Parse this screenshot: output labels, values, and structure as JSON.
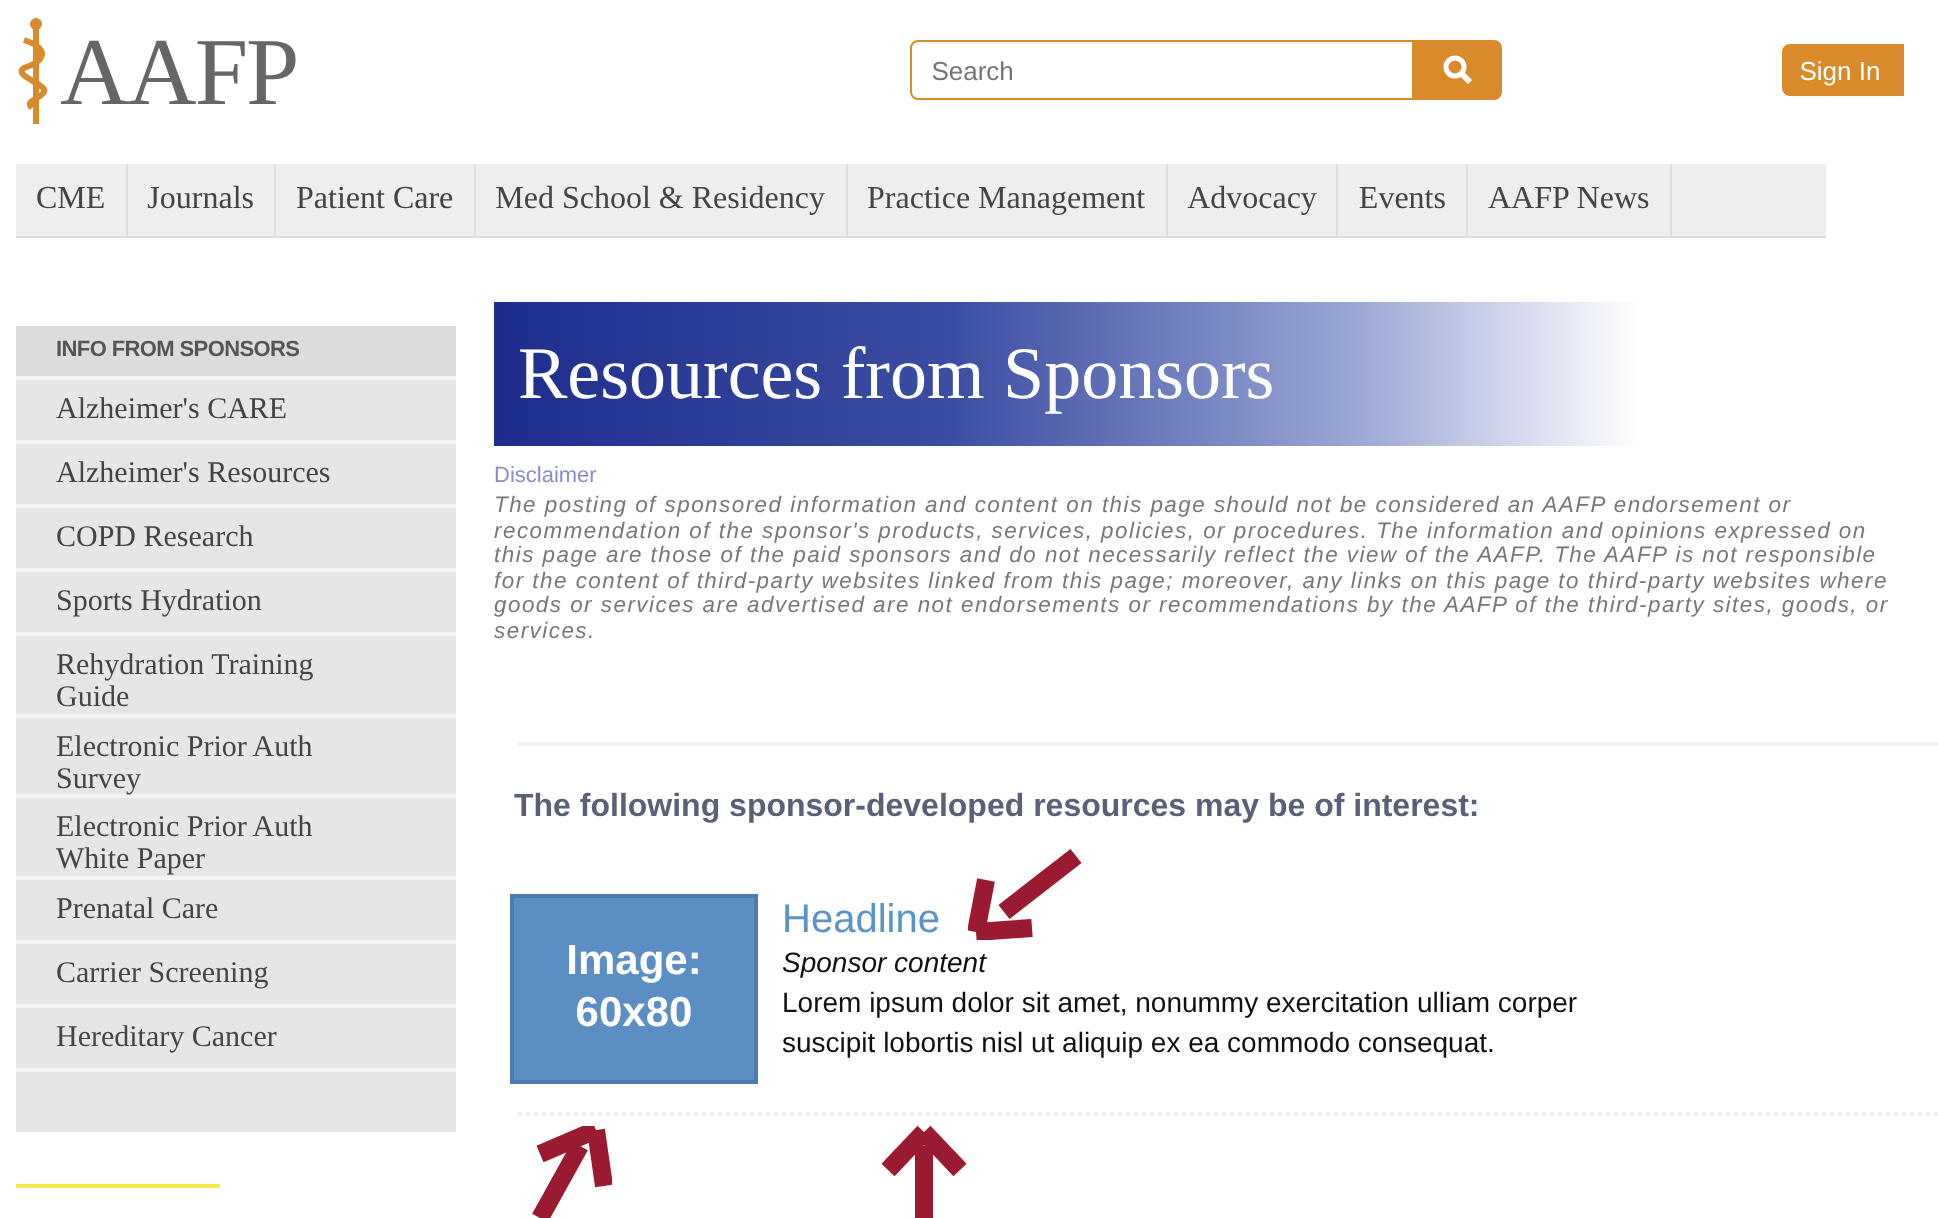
{
  "header": {
    "logo": "AAFP",
    "search": {
      "placeholder": "Search"
    },
    "sign_in": "Sign In"
  },
  "nav": [
    "CME",
    "Journals",
    "Patient Care",
    "Med School & Residency",
    "Practice Management",
    "Advocacy",
    "Events",
    "AAFP News"
  ],
  "sidebar": {
    "title": "INFO FROM SPONSORS",
    "items": [
      {
        "label": "Alzheimer's CARE"
      },
      {
        "label": "Alzheimer's Resources"
      },
      {
        "label": "COPD Research"
      },
      {
        "label": "Sports Hydration"
      },
      {
        "label": "Rehydration Training Guide"
      },
      {
        "label": "Electronic Prior Auth Survey"
      },
      {
        "label": "Electronic Prior Auth White Paper"
      },
      {
        "label": "Prenatal Care"
      },
      {
        "label": "Carrier Screening"
      },
      {
        "label": "Hereditary Cancer"
      }
    ]
  },
  "main": {
    "banner": "Resources from Sponsors",
    "disclaimer_link": "Disclaimer",
    "disclaimer": "The posting of sponsored information and content on this page should not be considered an AAFP endorsement or recommendation of the sponsor's products, services, policies, or procedures. The information and opinions expressed on this page are those of the paid sponsors and do not necessarily reflect the view of the AAFP. The AAFP is not responsible for the content of third-party websites linked from this page; moreover, any links on this page to third-party websites where goods or services are advertised are not endorsements or recommendations by the AAFP of the third-party sites, goods, or services.",
    "heading": "The following sponsor-developed resources may be of interest:",
    "resource": {
      "image_label": [
        "Image:",
        "60x80"
      ],
      "headline": "Headline",
      "subtitle": "Sponsor content",
      "body": "Lorem ipsum dolor sit amet, nonummy exercitation ulliam corper suscipit lobortis nisl ut aliquip ex ea commodo consequat."
    }
  }
}
